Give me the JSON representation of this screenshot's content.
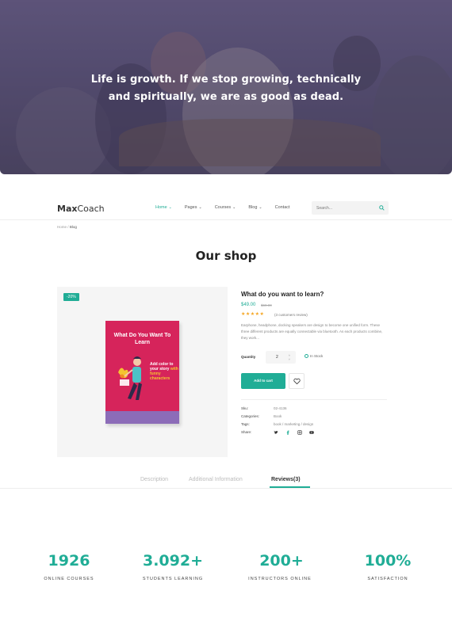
{
  "hero": {
    "quote_line1": "Life is growth. If we stop growing, technically",
    "quote_line2": "and spiritually, we are as good as dead."
  },
  "header": {
    "logo_bold": "Max",
    "logo_rest": "Coach",
    "nav": [
      {
        "label": "Home",
        "active": true
      },
      {
        "label": "Pages",
        "active": false
      },
      {
        "label": "Courses",
        "active": false
      },
      {
        "label": "Blog",
        "active": false
      },
      {
        "label": "Contact",
        "active": false
      }
    ],
    "search_placeholder": "Search..."
  },
  "breadcrumb": {
    "home": "Home",
    "sep": "/",
    "current": "Blog"
  },
  "shop": {
    "title": "Our shop",
    "product": {
      "badge": "-20%",
      "book_title": "What Do You Want To Learn",
      "book_sub1": "Add color to your story",
      "book_sub2": "with funny characters",
      "name": "What do you want to learn?",
      "price": "$49.00",
      "old_price": "$69.00",
      "rating": 5,
      "stars": "★★★★★",
      "reviews": "(3 customers review)",
      "description": "Earphone, headphone, docking speakers are design to become one unified form. These three different products are equally connectable via bluetooth. As each products combine, they work...",
      "quantity_label": "Quantity",
      "quantity": "2",
      "stock": "In Stock",
      "add_to_cart": "Add to cart",
      "sku_label": "Sku:",
      "sku": "02-4136",
      "categories_label": "Categories:",
      "categories": "Book",
      "tags_label": "Tags:",
      "tags": "book / marketing / design",
      "share_label": "Share:"
    }
  },
  "tabs": [
    {
      "label": "Description",
      "active": false
    },
    {
      "label": "Additional Information",
      "active": false
    },
    {
      "label": "Reviews(3)",
      "active": true
    }
  ],
  "stats": [
    {
      "value": "1926",
      "label": "ONLINE COURSES"
    },
    {
      "value": "3.092+",
      "label": "STUDENTS LEARNING"
    },
    {
      "value": "200+",
      "label": "INSTRUCTORS ONLINE"
    },
    {
      "value": "100%",
      "label": "SATISFACTION"
    }
  ],
  "colors": {
    "accent": "#20ad96",
    "sale_pink": "#d6245b",
    "star": "#f5a623"
  },
  "icons": {
    "search": "search-icon",
    "wishlist": "heart-icon",
    "stock": "check-circle-icon",
    "share": [
      "twitter-icon",
      "facebook-icon",
      "instagram-icon",
      "youtube-icon"
    ]
  }
}
